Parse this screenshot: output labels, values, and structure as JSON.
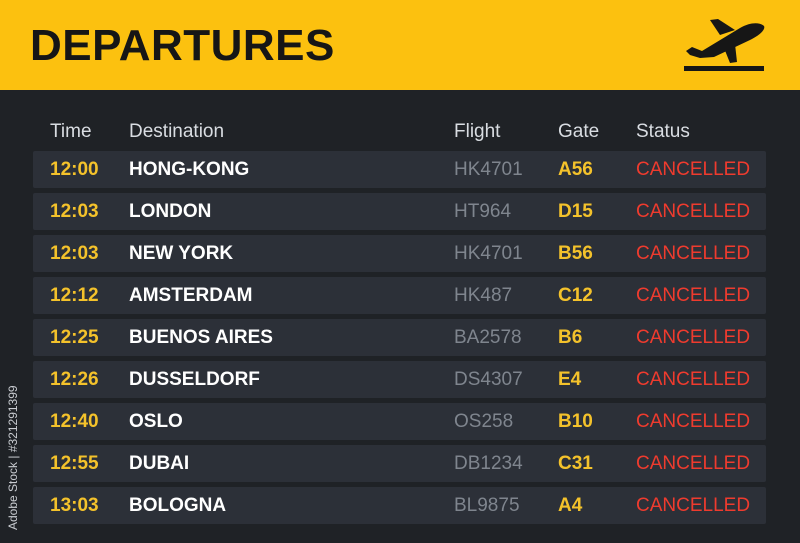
{
  "header": {
    "title": "DEPARTURES",
    "icon": "plane-departure-icon",
    "background_color": "#fcc10f"
  },
  "columns": {
    "time": "Time",
    "destination": "Destination",
    "flight": "Flight",
    "gate": "Gate",
    "status": "Status"
  },
  "flights": [
    {
      "time": "12:00",
      "destination": "HONG-KONG",
      "flight": "HK4701",
      "gate": "A56",
      "status": "CANCELLED"
    },
    {
      "time": "12:03",
      "destination": "LONDON",
      "flight": "HT964",
      "gate": "D15",
      "status": "CANCELLED"
    },
    {
      "time": "12:03",
      "destination": "NEW YORK",
      "flight": "HK4701",
      "gate": "B56",
      "status": "CANCELLED"
    },
    {
      "time": "12:12",
      "destination": "AMSTERDAM",
      "flight": "HK487",
      "gate": "C12",
      "status": "CANCELLED"
    },
    {
      "time": "12:25",
      "destination": "BUENOS AIRES",
      "flight": "BA2578",
      "gate": "B6",
      "status": "CANCELLED"
    },
    {
      "time": "12:26",
      "destination": "DUSSELDORF",
      "flight": "DS4307",
      "gate": "E4",
      "status": "CANCELLED"
    },
    {
      "time": "12:40",
      "destination": "OSLO",
      "flight": "OS258",
      "gate": "B10",
      "status": "CANCELLED"
    },
    {
      "time": "12:55",
      "destination": "DUBAI",
      "flight": "DB1234",
      "gate": "C31",
      "status": "CANCELLED"
    },
    {
      "time": "13:03",
      "destination": "BOLOGNA",
      "flight": "BL9875",
      "gate": "A4",
      "status": "CANCELLED"
    }
  ],
  "colors": {
    "accent": "#fcc10f",
    "time_and_gate": "#f4c22b",
    "status_cancelled": "#ef3b2e",
    "board_background": "#1f2226",
    "row_background": "#2c3038"
  },
  "credit": "Adobe Stock | #321291399"
}
